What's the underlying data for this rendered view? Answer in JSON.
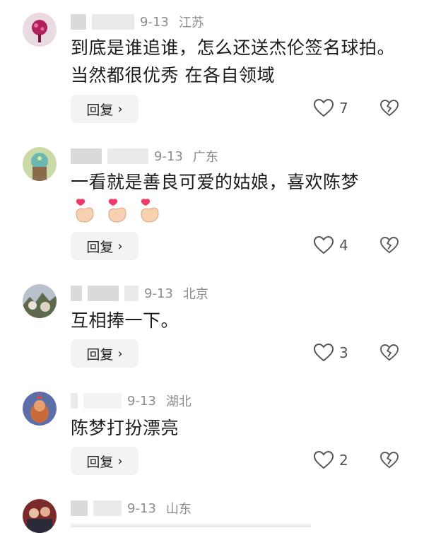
{
  "comments": [
    {
      "date": "9-13",
      "location": "江苏",
      "text": "到底是谁追谁，怎么还送杰伦签名球拍。当然都很优秀 在各自领域",
      "reply_label": "回复",
      "likes": "7"
    },
    {
      "date": "9-13",
      "location": "广东",
      "text": "一看就是善良可爱的姑娘，喜欢陈梦",
      "reply_label": "回复",
      "likes": "4"
    },
    {
      "date": "9-13",
      "location": "北京",
      "text": "互相捧一下。",
      "reply_label": "回复",
      "likes": "3"
    },
    {
      "date": "9-13",
      "location": "湖北",
      "text": "陈梦打扮漂亮",
      "reply_label": "回复",
      "likes": "2"
    },
    {
      "date": "9-13",
      "location": "山东"
    }
  ],
  "icons": {
    "like": "heart-outline-icon",
    "dislike": "broken-heart-icon",
    "reply_chevron": "chevron-right-icon",
    "finger_heart": "finger-heart-emoji"
  }
}
